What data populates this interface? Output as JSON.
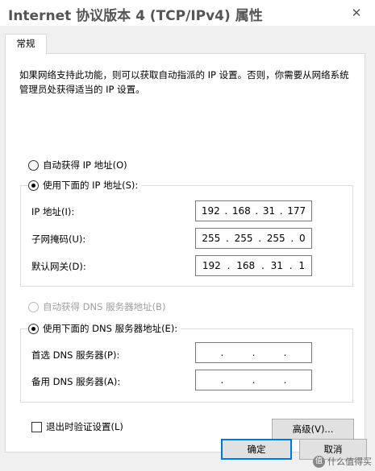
{
  "window": {
    "title": "Internet 协议版本 4 (TCP/IPv4) 属性",
    "close_glyph": "✕"
  },
  "tab": {
    "label": "常规"
  },
  "description": "如果网络支持此功能，则可以获取自动指派的 IP 设置。否则，你需要从网络系统管理员处获得适当的 IP 设置。",
  "ip_mode": {
    "auto_label": "自动获得 IP 地址(O)",
    "auto_checked": false,
    "manual_label": "使用下面的 IP 地址(S):",
    "manual_checked": true
  },
  "ip_fields": [
    {
      "label": "IP 地址(I):",
      "octets": [
        "192",
        "168",
        "31",
        "177"
      ]
    },
    {
      "label": "子网掩码(U):",
      "octets": [
        "255",
        "255",
        "255",
        "0"
      ]
    },
    {
      "label": "默认网关(D):",
      "octets": [
        "192",
        "168",
        "31",
        "1"
      ]
    }
  ],
  "dns_mode": {
    "auto_label": "自动获得 DNS 服务器地址(B)",
    "auto_checked": false,
    "auto_disabled": true,
    "manual_label": "使用下面的 DNS 服务器地址(E):",
    "manual_checked": true
  },
  "dns_fields": [
    {
      "label": "首选 DNS 服务器(P):",
      "octets": [
        "",
        "",
        "",
        ""
      ]
    },
    {
      "label": "备用 DNS 服务器(A):",
      "octets": [
        "",
        "",
        "",
        ""
      ]
    }
  ],
  "validate": {
    "label": "退出时验证设置(L)",
    "checked": false
  },
  "buttons": {
    "advanced": "高级(V)...",
    "ok": "确定",
    "cancel": "取消"
  },
  "watermark": {
    "logo_text": "值",
    "text": "什么值得买"
  }
}
